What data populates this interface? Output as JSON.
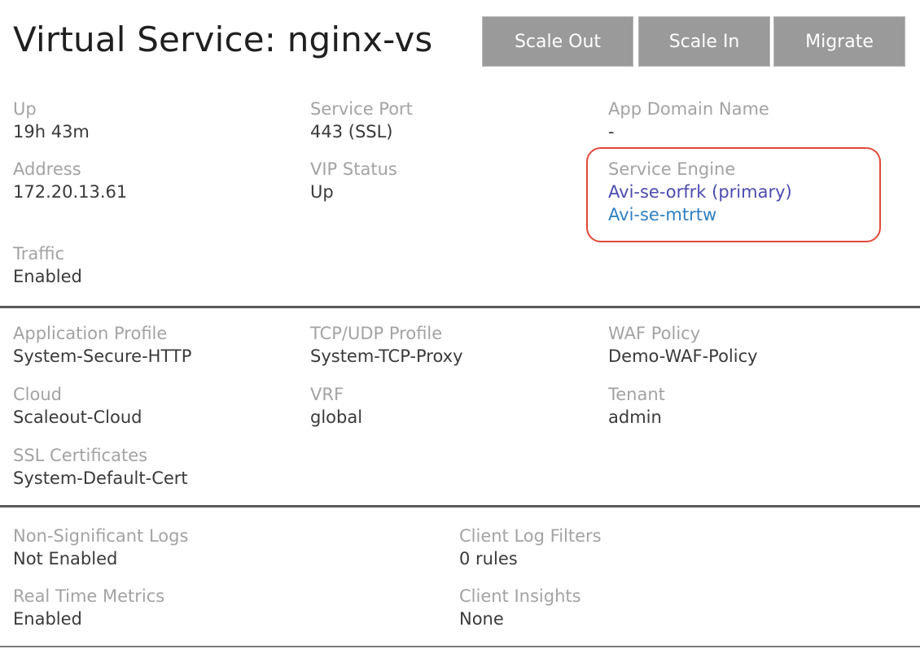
{
  "header": {
    "title": "Virtual Service:  nginx-vs",
    "buttons": {
      "scale_out": "Scale Out",
      "scale_in": "Scale In",
      "migrate": "Migrate"
    }
  },
  "summary": {
    "up": {
      "label": "Up",
      "value": "19h 43m"
    },
    "service_port": {
      "label": "Service Port",
      "value": "443 (SSL)"
    },
    "app_domain": {
      "label": "App Domain Name",
      "value": "-"
    },
    "address": {
      "label": "Address",
      "value": "172.20.13.61"
    },
    "vip_status": {
      "label": "VIP Status",
      "value": "Up"
    },
    "service_engine": {
      "label": "Service Engine",
      "primary": "Avi-se-orfrk (primary)",
      "secondary": "Avi-se-mtrtw",
      "primary_color": "#4b4bb0",
      "secondary_color": "#2f7fc1"
    },
    "traffic": {
      "label": "Traffic",
      "value": "Enabled"
    }
  },
  "profiles": {
    "app_profile": {
      "label": "Application Profile",
      "value": "System-Secure-HTTP"
    },
    "tcp_udp": {
      "label": "TCP/UDP Profile",
      "value": "System-TCP-Proxy"
    },
    "waf": {
      "label": "WAF Policy",
      "value": "Demo-WAF-Policy"
    },
    "cloud": {
      "label": "Cloud",
      "value": "Scaleout-Cloud"
    },
    "vrf": {
      "label": "VRF",
      "value": "global"
    },
    "tenant": {
      "label": "Tenant",
      "value": "admin"
    },
    "ssl": {
      "label": "SSL Certificates",
      "value": "System-Default-Cert"
    }
  },
  "logging": {
    "non_sig_logs": {
      "label": "Non-Significant Logs",
      "value": "Not Enabled"
    },
    "client_filters": {
      "label": "Client Log Filters",
      "value": "0 rules"
    },
    "realtime": {
      "label": "Real Time Metrics",
      "value": "Enabled"
    },
    "insights": {
      "label": "Client Insights",
      "value": "None"
    }
  },
  "colors": {
    "highlight_border": "#e1493a",
    "button_bg": "#9a9a9a"
  }
}
